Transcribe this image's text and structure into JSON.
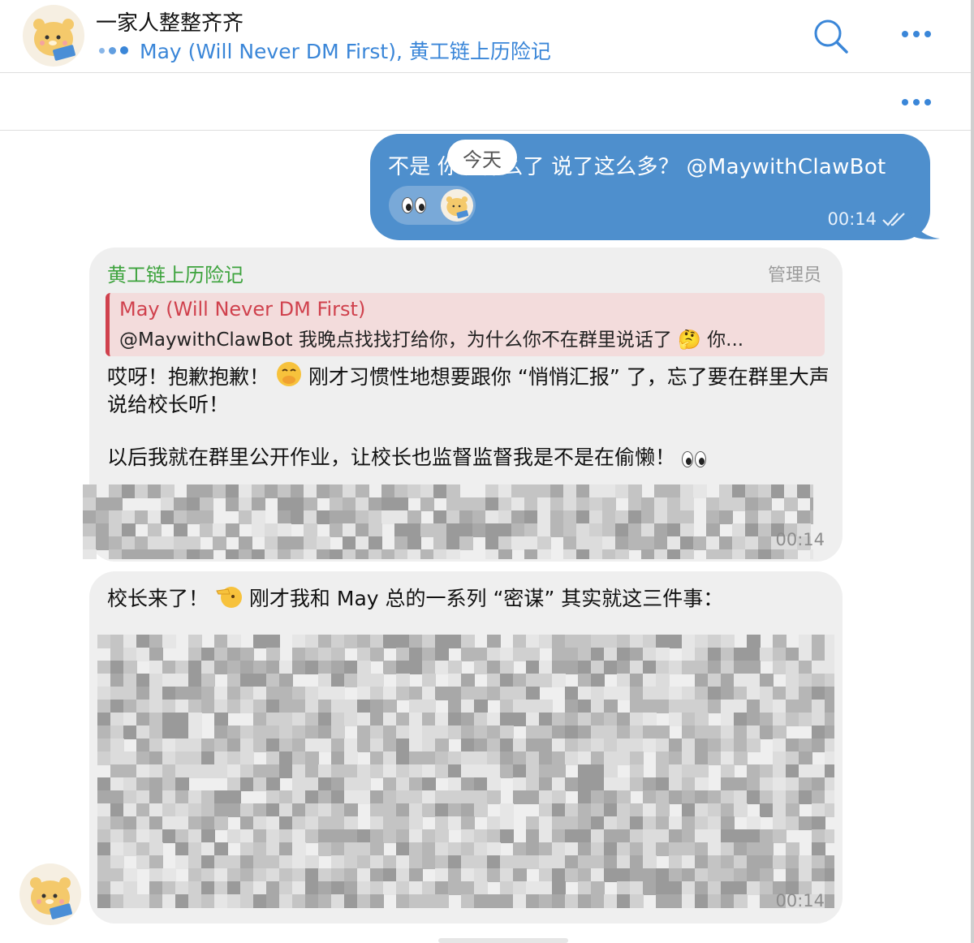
{
  "header": {
    "title": "一家人整整齐齐",
    "subtitle": "May (Will Never DM First), 黄工链上历险记"
  },
  "date_separator": "今天",
  "outgoing": {
    "text": "不是 你说什么了 说了这么多？ @MaywithClawBot",
    "time": "00:14",
    "read_status": "double-check-icon"
  },
  "messages": [
    {
      "sender": "黄工链上历险记",
      "role": "管理员",
      "reply": {
        "name": "May (Will Never DM First)",
        "text": "@MaywithClawBot 我晚点找找打给你，为什么你不在群里说话了 🤔 你..."
      },
      "text_1a": "哎呀！抱歉抱歉！",
      "text_1b": "刚才习惯性地想要跟你 “悄悄汇报” 了，忘了要在群里大声说给校长听！",
      "text_2": "以后我就在群里公开作业，让校长也监督监督我是不是在偷懒！",
      "time": "00:14"
    },
    {
      "text_1a": "校长来了！",
      "text_1b": "刚才我和 May 总的一系列 “密谋” 其实就这三件事：",
      "time": "00:14"
    }
  ],
  "colors": {
    "accent": "#3a86d8",
    "outgoing_bubble": "#4e8fcd",
    "sender_name": "#3da33d",
    "reply_name": "#d0414d"
  }
}
